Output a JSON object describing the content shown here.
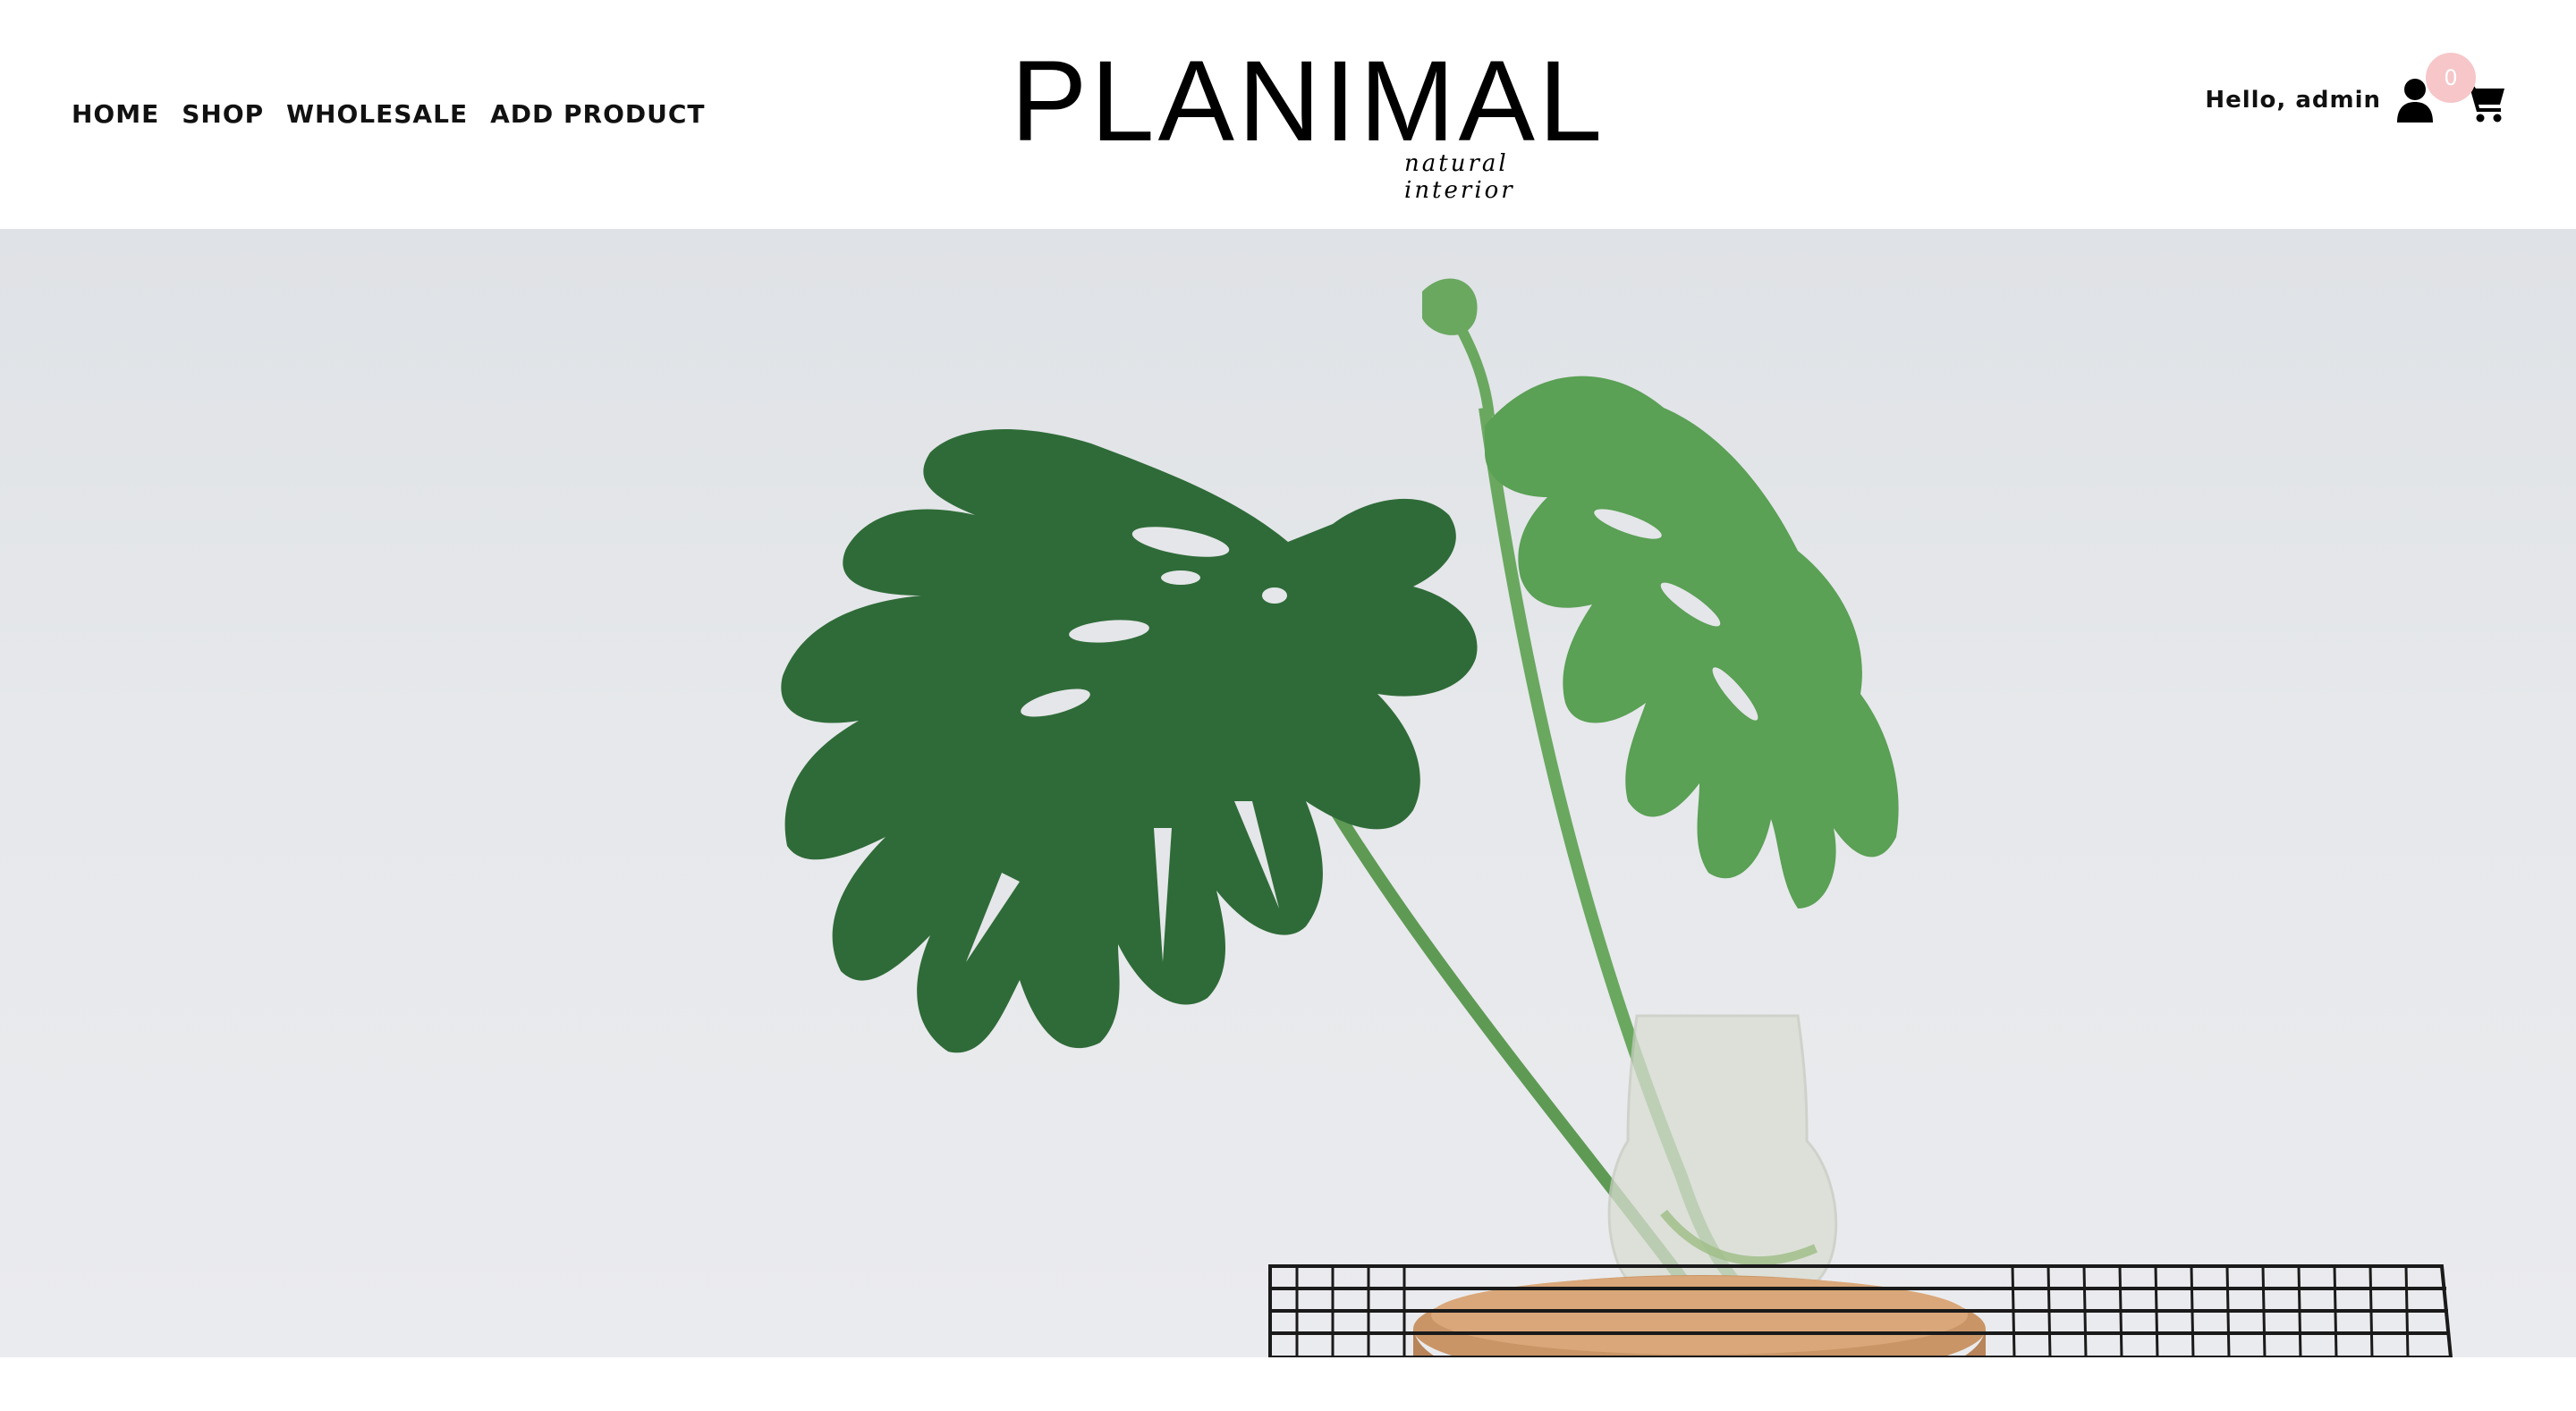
{
  "nav": {
    "items": [
      {
        "label": "HOME"
      },
      {
        "label": "SHOP"
      },
      {
        "label": "WHOLESALE"
      },
      {
        "label": "ADD PRODUCT"
      }
    ]
  },
  "logo": {
    "title": "PLANIMAL",
    "tagline": "natural interior"
  },
  "user": {
    "greeting": "Hello, admin",
    "icon": "user-icon"
  },
  "cart": {
    "count": "0",
    "icon": "cart-icon"
  },
  "hero": {
    "image": "monstera-leaves-in-glass-vase-on-wooden-tray"
  },
  "colors": {
    "badge": "#f6c6c9",
    "text": "#111111",
    "background": "#ffffff"
  }
}
